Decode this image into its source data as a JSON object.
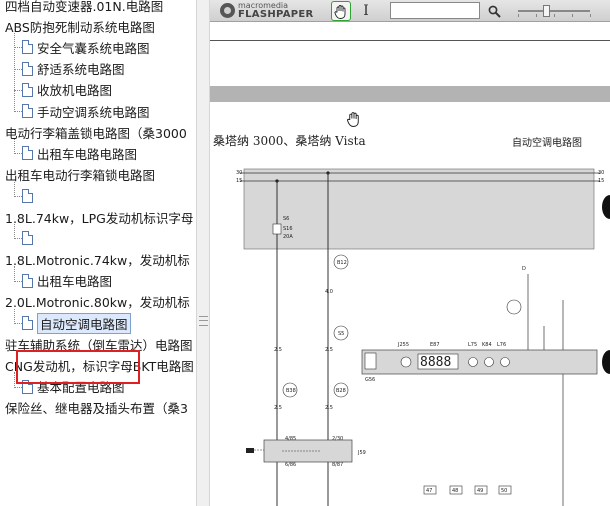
{
  "tree": {
    "items": [
      {
        "label": "四档自动变速器.01N.电路图",
        "level": 0,
        "icon": false
      },
      {
        "label": "ABS防抱死制动系统电路图",
        "level": 0,
        "icon": false
      },
      {
        "label": "安全气囊系统电路图",
        "level": 1,
        "icon": true
      },
      {
        "label": "舒适系统电路图",
        "level": 1,
        "icon": true
      },
      {
        "label": "收放机电路图",
        "level": 1,
        "icon": true
      },
      {
        "label": "手动空调系统电路图",
        "level": 1,
        "icon": true
      },
      {
        "label": "电动行李箱盖锁电路图（桑3000",
        "level": 0,
        "icon": false
      },
      {
        "label": "出租车电路电路图",
        "level": 1,
        "icon": true
      },
      {
        "label": "出租车电动行李箱锁电路图",
        "level": 0,
        "icon": false
      },
      {
        "label": "",
        "level": 1,
        "icon": true
      },
      {
        "label": "1.8L.74kw，LPG发动机标识字母",
        "level": 0,
        "icon": false
      },
      {
        "label": "",
        "level": 1,
        "icon": true
      },
      {
        "label": "1.8L.Motronic.74kw，发动机标",
        "level": 0,
        "icon": false
      },
      {
        "label": "出租车电路图",
        "level": 1,
        "icon": true
      },
      {
        "label": "2.0L.Motronic.80kw，发动机标",
        "level": 0,
        "icon": false
      },
      {
        "label": "自动空调电路图",
        "level": 1,
        "icon": true,
        "selected": true
      },
      {
        "label": "驻车辅助系统（倒车雷达）电路图",
        "level": 0,
        "icon": false
      },
      {
        "label": "CNG发动机，标识字母BKT电路图",
        "level": 0,
        "icon": false
      },
      {
        "label": "基本配置电路图",
        "level": 1,
        "icon": true
      },
      {
        "label": "保险丝、继电器及插头布置（桑3",
        "level": 0,
        "icon": false
      }
    ]
  },
  "viewer": {
    "brand_top": "macromedia",
    "brand_main": "FLASHPAPER",
    "search_value": "",
    "hand_icon": "hand-icon",
    "cursor_icon": "text-cursor-icon",
    "search_icon": "search-icon"
  },
  "page": {
    "title": "桑塔纳 3000、桑塔纳 Vista",
    "subtitle": "自动空调电路图"
  },
  "schematic": {
    "rail_labels_left": [
      "30",
      "15",
      "X",
      "31"
    ],
    "rail_labels_right": [
      "30",
      "15",
      "X",
      "31"
    ],
    "fuse": [
      "S6",
      "S16",
      "20A"
    ],
    "wire_marks": [
      "B12",
      "S",
      "4.0",
      "S",
      "S",
      "2.5",
      "2.5",
      "2.5",
      "2.5"
    ],
    "circles": [
      "B12",
      "S5",
      "S6",
      "B38",
      "B28"
    ],
    "d_label": "D",
    "panel_labels": [
      "J255",
      "E87",
      "L75",
      "K84",
      "L76"
    ],
    "display_digits": "8888",
    "g_label": "G56",
    "j_label": "J59",
    "j_contacts": [
      "4/85",
      "6/86",
      "2/30",
      "8/87"
    ],
    "bottom_boxes": [
      "47",
      "48",
      "49",
      "50"
    ]
  },
  "colors": {
    "highlight": "#e02020",
    "hand_button_border": "#2fa32f",
    "band": "#b3b3b3",
    "panel": "#d7d7d7"
  }
}
